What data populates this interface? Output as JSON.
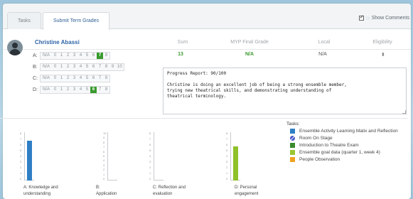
{
  "tabs": [
    "Tasks",
    "Submit Term Grades"
  ],
  "show_comments_label": "Show Comments",
  "student_name": "Christine Abassi",
  "columns": {
    "sum": "Sum",
    "myp": "MYP Final Grade",
    "local": "Local",
    "eligibility": "Eligibility"
  },
  "criteria": [
    {
      "letter": "A:",
      "levels": [
        "N/A",
        "0",
        "1",
        "2",
        "3",
        "4",
        "5",
        "6",
        "7",
        "8"
      ],
      "selected": "7"
    },
    {
      "letter": "B:",
      "levels": [
        "N/A",
        "0",
        "1",
        "2",
        "3",
        "4",
        "5",
        "6",
        "7",
        "8",
        "9",
        "10"
      ],
      "selected": null
    },
    {
      "letter": "C:",
      "levels": [
        "N/A",
        "0",
        "1",
        "2",
        "3",
        "4",
        "5",
        "6",
        "7",
        "8"
      ],
      "selected": null
    },
    {
      "letter": "D:",
      "levels": [
        "N/A",
        "0",
        "1",
        "2",
        "3",
        "4",
        "5",
        "6",
        "7",
        "8"
      ],
      "selected": "6"
    }
  ],
  "values": {
    "sum": "13",
    "myp": "N/A",
    "local": "N/A",
    "eligibility": "⬍"
  },
  "progress_report": "Progress Report: 90/100\n\nChristine is doing an excellent job of being a strong ensemble member,\ntrying new theatrical skills, and demonstrating understanding of\ntheatrical terminology.",
  "chart_labels": {
    "a": [
      "A: Knowledge and",
      "understanding"
    ],
    "b": [
      "B:",
      "Application"
    ],
    "c": [
      "C: Reflection and",
      "evaluation"
    ],
    "d": [
      "D: Personal",
      "engagement"
    ]
  },
  "chart_data": [
    {
      "type": "bar",
      "categories": [
        "A: Knowledge and understanding"
      ],
      "values": [
        7
      ],
      "ylim": [
        0,
        8
      ],
      "color": "#2f7fc4"
    },
    {
      "type": "bar",
      "categories": [
        "B: Application"
      ],
      "values": [
        0
      ],
      "ylim": [
        0,
        10
      ]
    },
    {
      "type": "bar",
      "categories": [
        "C: Reflection and evaluation"
      ],
      "values": [
        0
      ],
      "ylim": [
        0,
        8
      ]
    },
    {
      "type": "bar",
      "categories": [
        "D: Personal engagement"
      ],
      "values": [
        6
      ],
      "ylim": [
        0,
        8
      ],
      "color": "#8fc12a"
    }
  ],
  "tasks_title": "Tasks:",
  "tasks": [
    {
      "label": "Ensemble Activity Learning Matix and Reflection",
      "color": "#2f7fc4",
      "icon": "square-icon"
    },
    {
      "label": "Room On Stage",
      "color": "#4a58c8",
      "icon": "no-entry-icon"
    },
    {
      "label": "Introduction to Theatre Exam",
      "color": "#3a8a2e",
      "icon": "square-icon"
    },
    {
      "label": "Ensemble goal data (quarter 1, week 4)",
      "color": "#9cc531",
      "icon": "square-icon"
    },
    {
      "label": "People Observation",
      "color": "#f0a321",
      "icon": "square-icon"
    }
  ]
}
